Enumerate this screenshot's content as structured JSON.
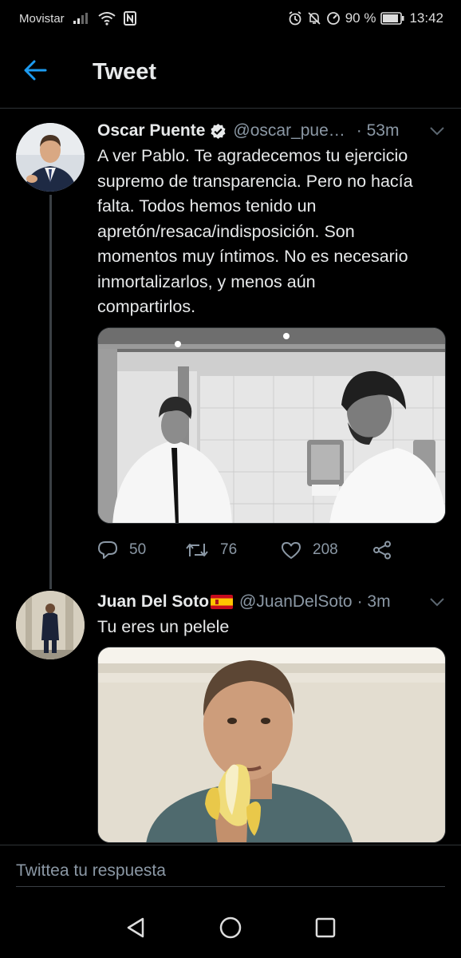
{
  "status_bar": {
    "carrier": "Movistar",
    "battery": "90 %",
    "time": "13:42"
  },
  "header": {
    "title": "Tweet"
  },
  "tweets": [
    {
      "name": "Oscar Puente",
      "verified": true,
      "handle": "@oscar_pue…",
      "time": "· 53m",
      "text": "A ver Pablo. Te agradecemos tu ejercicio supremo de transparencia. Pero no hacía falta. Todos hemos tenido un apretón/resaca/indisposición. Son momentos muy íntimos. No es necesario inmortalizarlos, y menos aún compartirlos.",
      "stats": {
        "replies": "50",
        "retweets": "76",
        "likes": "208"
      }
    },
    {
      "name": "Juan Del Soto",
      "flag": "spain-flag",
      "handle": "@JuanDelSoto",
      "time": "· 3m",
      "text": "Tu eres un pelele"
    }
  ],
  "reply": {
    "placeholder": "Twittea tu respuesta"
  },
  "colors": {
    "accent": "#1d9bf0",
    "text": "#e7e9ea",
    "muted": "#8b98a5",
    "divider": "#2f3336"
  },
  "icons": [
    "arrow-left-icon",
    "verified-icon",
    "chevron-down-icon",
    "reply-icon",
    "retweet-icon",
    "like-icon",
    "share-icon",
    "nav-back-icon",
    "nav-home-icon",
    "nav-recents-icon"
  ]
}
